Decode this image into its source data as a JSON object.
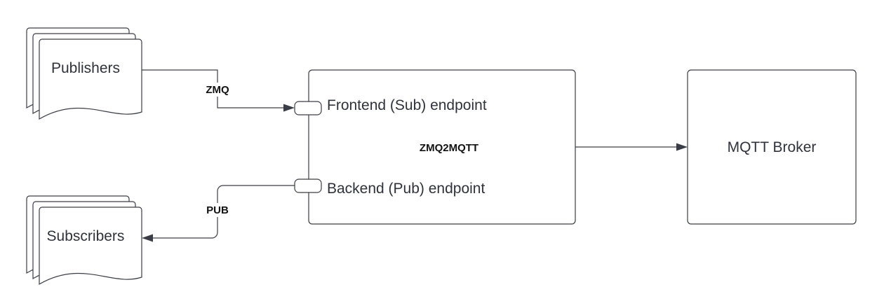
{
  "nodes": {
    "publishers": {
      "label": "Publishers"
    },
    "subscribers": {
      "label": "Subscribers"
    },
    "zmq2mqtt": {
      "label": "ZMQ2MQTT",
      "frontend_label": "Frontend (Sub) endpoint",
      "backend_label": "Backend (Pub) endpoint"
    },
    "mqtt_broker": {
      "label": "MQTT Broker"
    }
  },
  "edges": {
    "publishers_to_frontend": {
      "label": "ZMQ"
    },
    "backend_to_subscribers": {
      "label": "PUB"
    },
    "zmq2mqtt_to_broker": {
      "label": ""
    }
  },
  "colors": {
    "stroke": "#3a3d45",
    "text": "#2f323a",
    "background": "#ffffff"
  }
}
